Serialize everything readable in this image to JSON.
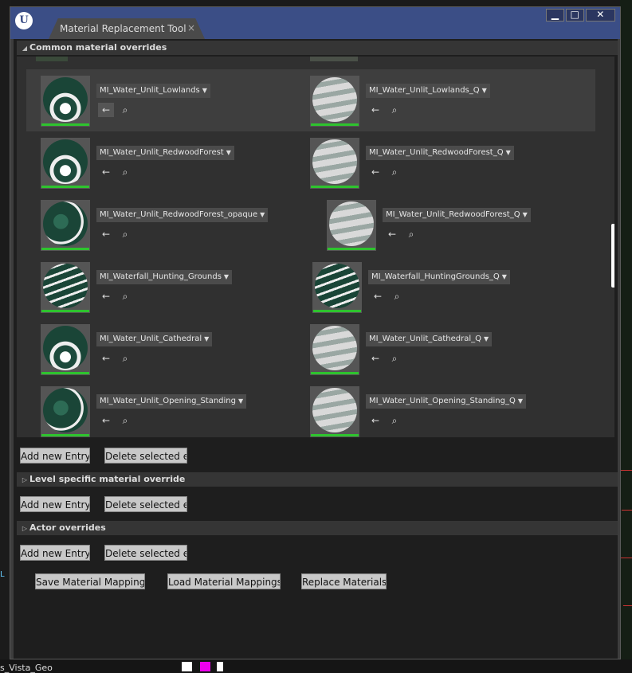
{
  "window": {
    "tab_title": "Material Replacement Tool",
    "tab_close": "×",
    "btn_min": "▁",
    "btn_max": "□",
    "btn_close": "✕"
  },
  "sections": {
    "common": "Common material overrides",
    "level": "Level specific material override",
    "actor": "Actor overrides"
  },
  "rows": [
    {
      "left": "MI_Water_Unlit_Lowlands",
      "right": "MI_Water_Unlit_Lowlands_Q"
    },
    {
      "left": "MI_Water_Unlit_RedwoodForest",
      "right": "MI_Water_Unlit_RedwoodForest_Q"
    },
    {
      "left": "MI_Water_Unlit_RedwoodForest_opaque",
      "right": "MI_Water_Unlit_RedwoodForest_Q"
    },
    {
      "left": "MI_Waterfall_Hunting_Grounds",
      "right": "MI_Waterfall_HuntingGrounds_Q"
    },
    {
      "left": "MI_Water_Unlit_Cathedral",
      "right": "MI_Water_Unlit_Cathedral_Q"
    },
    {
      "left": "MI_Water_Unlit_Opening_Standing",
      "right": "MI_Water_Unlit_Opening_Standing_Q"
    }
  ],
  "buttons": {
    "add_entry": "Add new Entry",
    "delete_entry": "Delete selected er",
    "save": "Save Material Mappings",
    "load": "Load Material Mappings",
    "replace": "Replace Materials"
  },
  "background": {
    "bottom_left": "s_Vista_Geo",
    "left_letter": "L"
  },
  "icons": {
    "use_selected": "←",
    "browse": "⌕"
  }
}
